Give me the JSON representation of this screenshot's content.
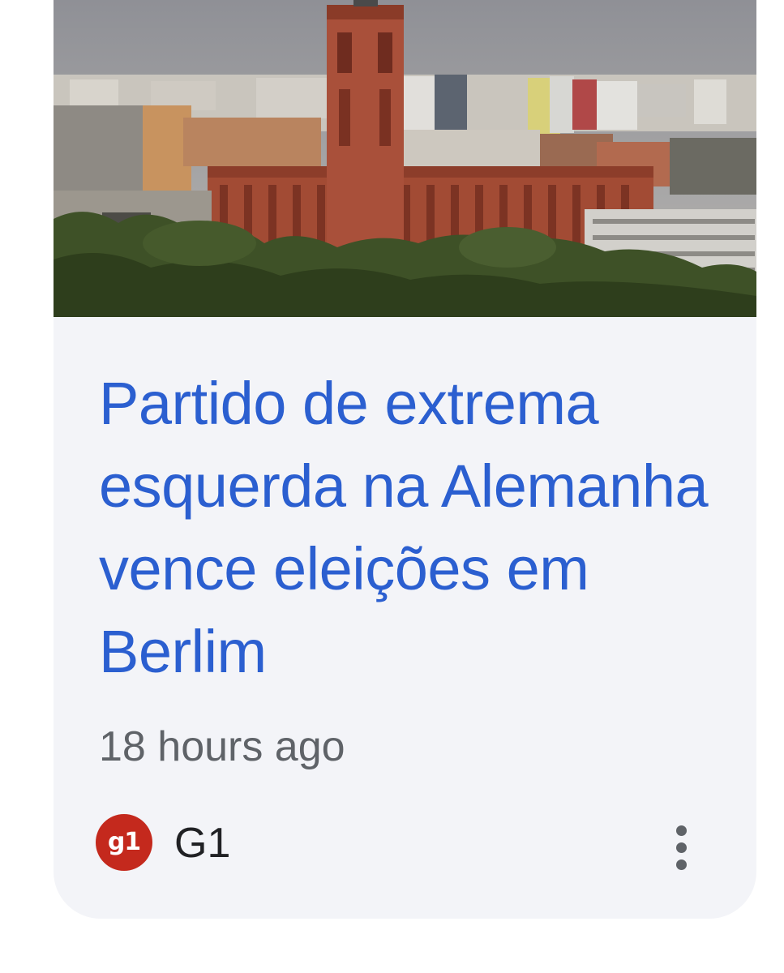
{
  "article": {
    "headline": "Partido de extrema esquerda na Alemanha vence eleições em Berlim",
    "time_ago": "18 hours ago",
    "thumbnail_description": "city skyline with red brick clock tower building"
  },
  "source": {
    "logo_text": "g1",
    "name": "G1",
    "logo_color": "#c4291d"
  },
  "colors": {
    "headline": "#2b5fd0",
    "card_background": "#f3f4f8",
    "meta_text": "#5f6368"
  },
  "icons": {
    "menu": "more-vert-icon"
  }
}
